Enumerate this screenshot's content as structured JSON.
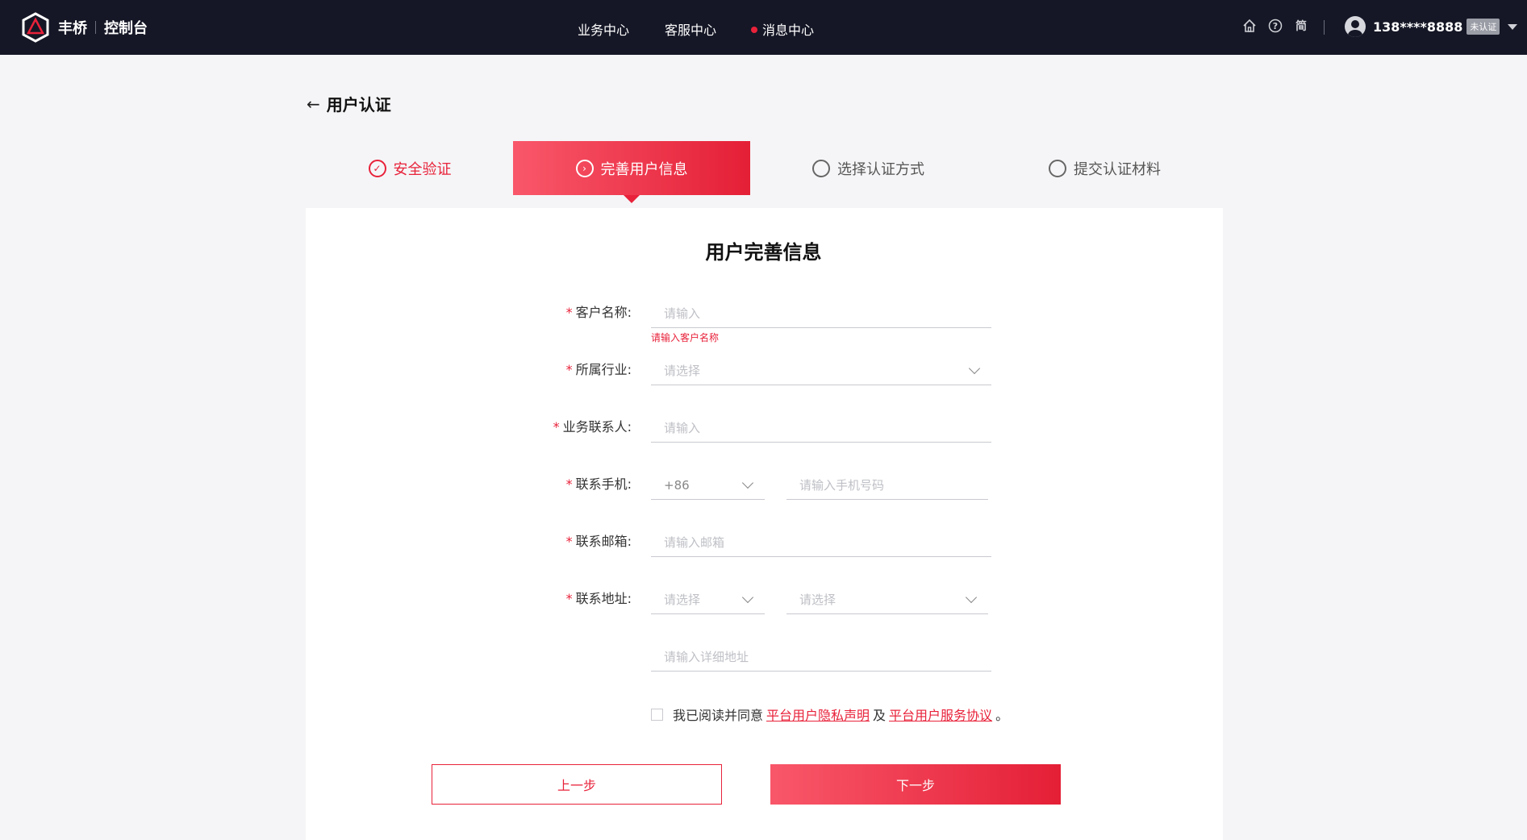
{
  "header": {
    "brand": "丰桥",
    "console": "控制台",
    "nav": [
      {
        "label": "业务中心"
      },
      {
        "label": "客服中心"
      },
      {
        "label": "消息中心"
      }
    ],
    "icons": [
      "home-icon",
      "help-icon",
      "language-icon"
    ],
    "lang_label": "简",
    "user_phone": "138****8888",
    "user_badge": "未认证"
  },
  "page": {
    "title": "用户认证"
  },
  "steps": [
    {
      "label": "安全验证",
      "state": "done"
    },
    {
      "label": "完善用户信息",
      "state": "active"
    },
    {
      "label": "选择认证方式",
      "state": "pending"
    },
    {
      "label": "提交认证材料",
      "state": "pending"
    }
  ],
  "form": {
    "title": "用户完善信息",
    "required_mark": "*",
    "customer_name": {
      "label": "客户名称:",
      "placeholder": "请输入",
      "error": "请输入客户名称"
    },
    "industry": {
      "label": "所属行业:",
      "placeholder": "请选择"
    },
    "contact_person": {
      "label": "业务联系人:",
      "placeholder": "请输入"
    },
    "phone": {
      "label": "联系手机:",
      "country_code": "+86",
      "placeholder": "请输入手机号码"
    },
    "email": {
      "label": "联系邮箱:",
      "placeholder": "请输入邮箱"
    },
    "address": {
      "label": "联系地址:",
      "province_placeholder": "请选择",
      "city_placeholder": "请选择",
      "detail_placeholder": "请输入详细地址"
    },
    "agreement": {
      "prefix": "我已阅读并同意",
      "privacy_link": "平台用户隐私声明",
      "conjunction": "及",
      "service_link": "平台用户服务协议",
      "suffix": "。"
    },
    "prev_label": "上一步",
    "next_label": "下一步"
  },
  "colors": {
    "accent": "#e8223a",
    "topbar": "#151726"
  }
}
